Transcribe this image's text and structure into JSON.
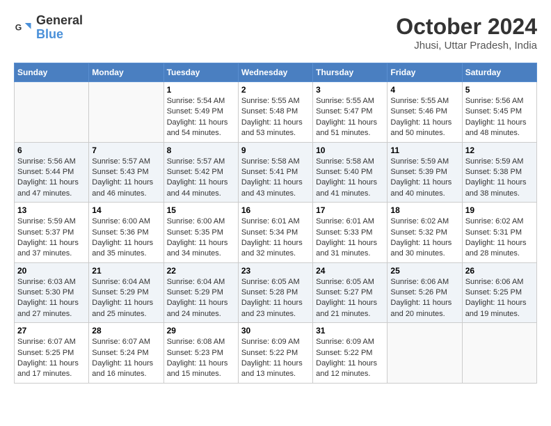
{
  "logo": {
    "line1": "General",
    "line2": "Blue"
  },
  "title": "October 2024",
  "location": "Jhusi, Uttar Pradesh, India",
  "days_of_week": [
    "Sunday",
    "Monday",
    "Tuesday",
    "Wednesday",
    "Thursday",
    "Friday",
    "Saturday"
  ],
  "weeks": [
    [
      {
        "day": "",
        "sunrise": "",
        "sunset": "",
        "daylight": ""
      },
      {
        "day": "",
        "sunrise": "",
        "sunset": "",
        "daylight": ""
      },
      {
        "day": "1",
        "sunrise": "Sunrise: 5:54 AM",
        "sunset": "Sunset: 5:49 PM",
        "daylight": "Daylight: 11 hours and 54 minutes."
      },
      {
        "day": "2",
        "sunrise": "Sunrise: 5:55 AM",
        "sunset": "Sunset: 5:48 PM",
        "daylight": "Daylight: 11 hours and 53 minutes."
      },
      {
        "day": "3",
        "sunrise": "Sunrise: 5:55 AM",
        "sunset": "Sunset: 5:47 PM",
        "daylight": "Daylight: 11 hours and 51 minutes."
      },
      {
        "day": "4",
        "sunrise": "Sunrise: 5:55 AM",
        "sunset": "Sunset: 5:46 PM",
        "daylight": "Daylight: 11 hours and 50 minutes."
      },
      {
        "day": "5",
        "sunrise": "Sunrise: 5:56 AM",
        "sunset": "Sunset: 5:45 PM",
        "daylight": "Daylight: 11 hours and 48 minutes."
      }
    ],
    [
      {
        "day": "6",
        "sunrise": "Sunrise: 5:56 AM",
        "sunset": "Sunset: 5:44 PM",
        "daylight": "Daylight: 11 hours and 47 minutes."
      },
      {
        "day": "7",
        "sunrise": "Sunrise: 5:57 AM",
        "sunset": "Sunset: 5:43 PM",
        "daylight": "Daylight: 11 hours and 46 minutes."
      },
      {
        "day": "8",
        "sunrise": "Sunrise: 5:57 AM",
        "sunset": "Sunset: 5:42 PM",
        "daylight": "Daylight: 11 hours and 44 minutes."
      },
      {
        "day": "9",
        "sunrise": "Sunrise: 5:58 AM",
        "sunset": "Sunset: 5:41 PM",
        "daylight": "Daylight: 11 hours and 43 minutes."
      },
      {
        "day": "10",
        "sunrise": "Sunrise: 5:58 AM",
        "sunset": "Sunset: 5:40 PM",
        "daylight": "Daylight: 11 hours and 41 minutes."
      },
      {
        "day": "11",
        "sunrise": "Sunrise: 5:59 AM",
        "sunset": "Sunset: 5:39 PM",
        "daylight": "Daylight: 11 hours and 40 minutes."
      },
      {
        "day": "12",
        "sunrise": "Sunrise: 5:59 AM",
        "sunset": "Sunset: 5:38 PM",
        "daylight": "Daylight: 11 hours and 38 minutes."
      }
    ],
    [
      {
        "day": "13",
        "sunrise": "Sunrise: 5:59 AM",
        "sunset": "Sunset: 5:37 PM",
        "daylight": "Daylight: 11 hours and 37 minutes."
      },
      {
        "day": "14",
        "sunrise": "Sunrise: 6:00 AM",
        "sunset": "Sunset: 5:36 PM",
        "daylight": "Daylight: 11 hours and 35 minutes."
      },
      {
        "day": "15",
        "sunrise": "Sunrise: 6:00 AM",
        "sunset": "Sunset: 5:35 PM",
        "daylight": "Daylight: 11 hours and 34 minutes."
      },
      {
        "day": "16",
        "sunrise": "Sunrise: 6:01 AM",
        "sunset": "Sunset: 5:34 PM",
        "daylight": "Daylight: 11 hours and 32 minutes."
      },
      {
        "day": "17",
        "sunrise": "Sunrise: 6:01 AM",
        "sunset": "Sunset: 5:33 PM",
        "daylight": "Daylight: 11 hours and 31 minutes."
      },
      {
        "day": "18",
        "sunrise": "Sunrise: 6:02 AM",
        "sunset": "Sunset: 5:32 PM",
        "daylight": "Daylight: 11 hours and 30 minutes."
      },
      {
        "day": "19",
        "sunrise": "Sunrise: 6:02 AM",
        "sunset": "Sunset: 5:31 PM",
        "daylight": "Daylight: 11 hours and 28 minutes."
      }
    ],
    [
      {
        "day": "20",
        "sunrise": "Sunrise: 6:03 AM",
        "sunset": "Sunset: 5:30 PM",
        "daylight": "Daylight: 11 hours and 27 minutes."
      },
      {
        "day": "21",
        "sunrise": "Sunrise: 6:04 AM",
        "sunset": "Sunset: 5:29 PM",
        "daylight": "Daylight: 11 hours and 25 minutes."
      },
      {
        "day": "22",
        "sunrise": "Sunrise: 6:04 AM",
        "sunset": "Sunset: 5:29 PM",
        "daylight": "Daylight: 11 hours and 24 minutes."
      },
      {
        "day": "23",
        "sunrise": "Sunrise: 6:05 AM",
        "sunset": "Sunset: 5:28 PM",
        "daylight": "Daylight: 11 hours and 23 minutes."
      },
      {
        "day": "24",
        "sunrise": "Sunrise: 6:05 AM",
        "sunset": "Sunset: 5:27 PM",
        "daylight": "Daylight: 11 hours and 21 minutes."
      },
      {
        "day": "25",
        "sunrise": "Sunrise: 6:06 AM",
        "sunset": "Sunset: 5:26 PM",
        "daylight": "Daylight: 11 hours and 20 minutes."
      },
      {
        "day": "26",
        "sunrise": "Sunrise: 6:06 AM",
        "sunset": "Sunset: 5:25 PM",
        "daylight": "Daylight: 11 hours and 19 minutes."
      }
    ],
    [
      {
        "day": "27",
        "sunrise": "Sunrise: 6:07 AM",
        "sunset": "Sunset: 5:25 PM",
        "daylight": "Daylight: 11 hours and 17 minutes."
      },
      {
        "day": "28",
        "sunrise": "Sunrise: 6:07 AM",
        "sunset": "Sunset: 5:24 PM",
        "daylight": "Daylight: 11 hours and 16 minutes."
      },
      {
        "day": "29",
        "sunrise": "Sunrise: 6:08 AM",
        "sunset": "Sunset: 5:23 PM",
        "daylight": "Daylight: 11 hours and 15 minutes."
      },
      {
        "day": "30",
        "sunrise": "Sunrise: 6:09 AM",
        "sunset": "Sunset: 5:22 PM",
        "daylight": "Daylight: 11 hours and 13 minutes."
      },
      {
        "day": "31",
        "sunrise": "Sunrise: 6:09 AM",
        "sunset": "Sunset: 5:22 PM",
        "daylight": "Daylight: 11 hours and 12 minutes."
      },
      {
        "day": "",
        "sunrise": "",
        "sunset": "",
        "daylight": ""
      },
      {
        "day": "",
        "sunrise": "",
        "sunset": "",
        "daylight": ""
      }
    ]
  ]
}
